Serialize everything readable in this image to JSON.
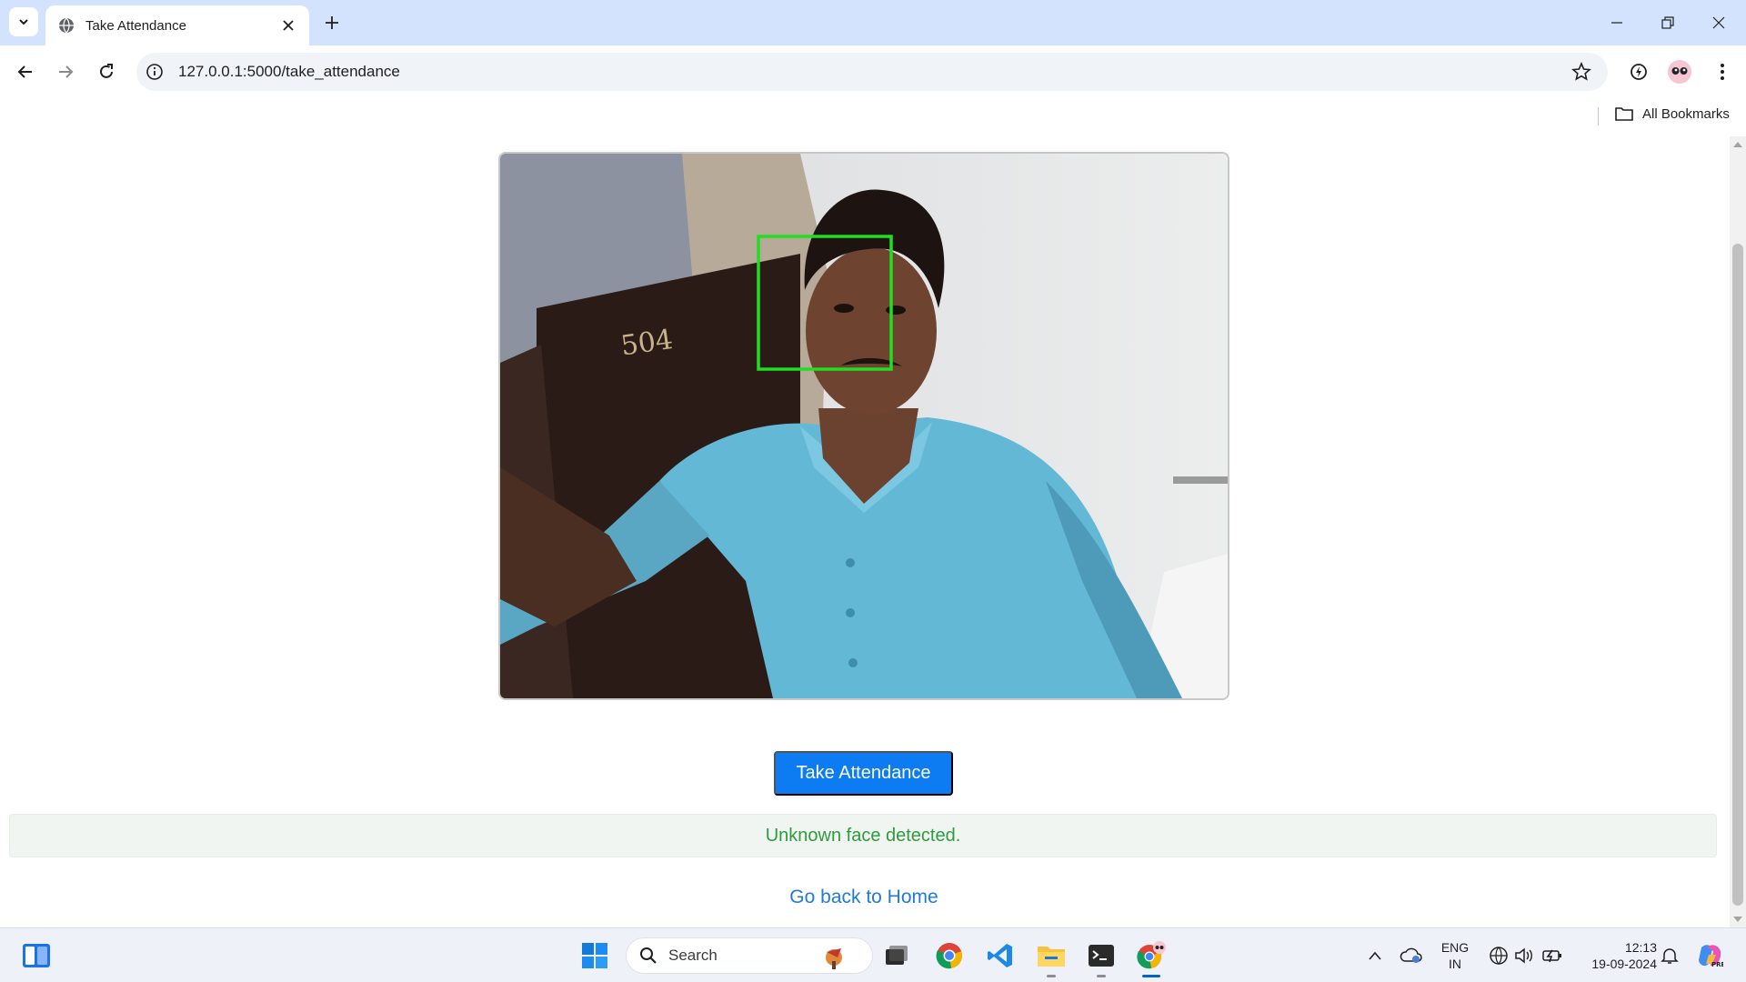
{
  "browser": {
    "tab_title": "Take Attendance",
    "url": "127.0.0.1:5000/take_attendance",
    "bookmarks_label": "All Bookmarks"
  },
  "page": {
    "take_button_label": "Take Attendance",
    "status_message": "Unknown face detected.",
    "home_link": "Go back to Home",
    "camera_feed": {
      "door_number": "504",
      "face_box_color": "#22dd22"
    }
  },
  "taskbar": {
    "search_placeholder": "Search",
    "lang_line1": "ENG",
    "lang_line2": "IN",
    "time": "12:13",
    "date": "19-09-2024"
  },
  "colors": {
    "accent": "#0d7cf2",
    "success_text": "#2e9c3e",
    "link": "#1f7ad9"
  }
}
